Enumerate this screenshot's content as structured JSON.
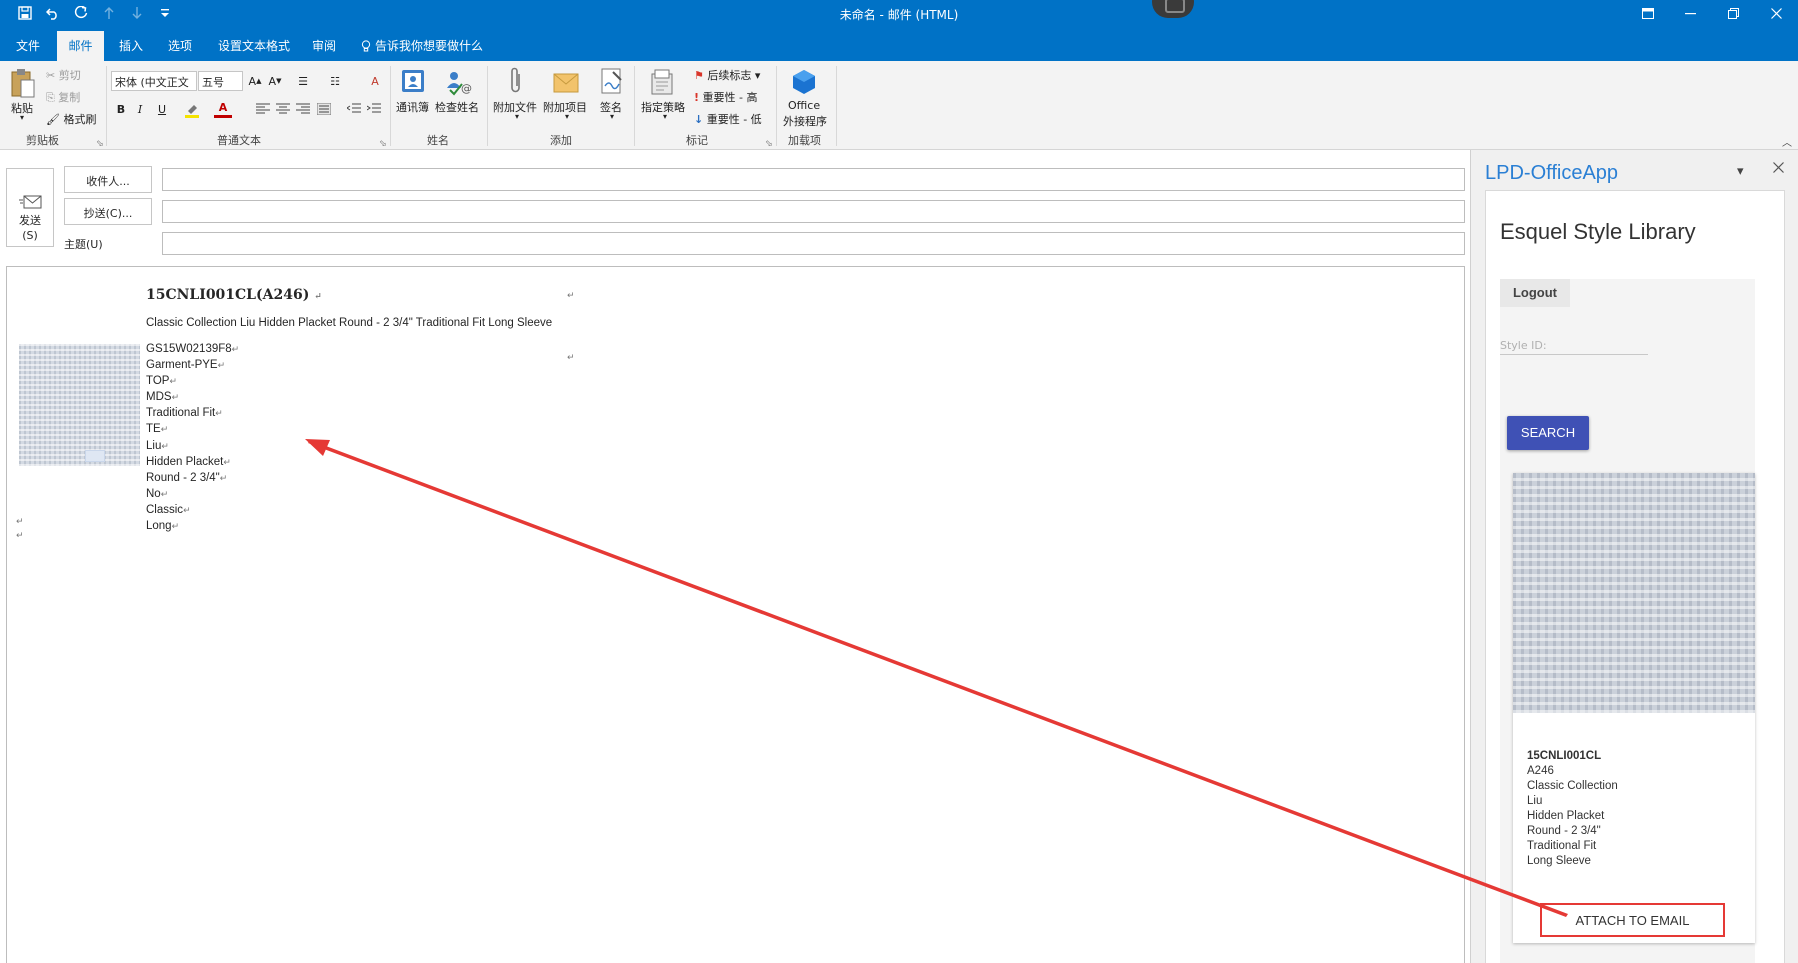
{
  "window": {
    "title": "未命名  -  邮件 (HTML)"
  },
  "tabs": [
    {
      "label": "文件"
    },
    {
      "label": "邮件"
    },
    {
      "label": "插入"
    },
    {
      "label": "选项"
    },
    {
      "label": "设置文本格式"
    },
    {
      "label": "审阅"
    },
    {
      "label": "告诉我你想要做什么"
    }
  ],
  "ribbon": {
    "clipboard": {
      "group_label": "剪贴板",
      "paste": "粘贴",
      "cut": "剪切",
      "copy": "复制",
      "format_painter": "格式刷"
    },
    "basic_text": {
      "group_label": "普通文本",
      "font_name": "宋体 (中文正文",
      "font_size": "五号",
      "bold": "B",
      "italic": "I",
      "underline": "U",
      "font_color_letter": "A"
    },
    "names": {
      "group_label": "姓名",
      "address_book": "通讯簿",
      "check_names": "检查姓名"
    },
    "include": {
      "group_label": "添加",
      "attach_file": "附加文件",
      "attach_item": "附加项目",
      "signature": "签名"
    },
    "tags": {
      "group_label": "标记",
      "assign_policy": "指定策略",
      "follow_up": "后续标志",
      "high_importance": "重要性 - 高",
      "low_importance": "重要性 - 低"
    },
    "addins": {
      "group_label": "加载项",
      "office_addins_line1": "Office",
      "office_addins_line2": "外接程序"
    }
  },
  "compose": {
    "send_label_1": "发送",
    "send_label_2": "(S)",
    "to_button": "收件人...",
    "cc_button": "抄送(C)...",
    "subject_label": "主题(U)",
    "to_value": "",
    "cc_value": "",
    "subject_value": ""
  },
  "body": {
    "title": "15CNLI001CL(A246)",
    "subtitle": "Classic Collection Liu Hidden Placket Round - 2 3/4\" Traditional Fit Long Sleeve",
    "specs": [
      "GS15W02139F8",
      "Garment-PYE",
      "TOP",
      "MDS",
      "Traditional Fit",
      "TE",
      "Liu",
      "Hidden Placket",
      "Round - 2 3/4\"",
      "No",
      "Classic",
      "Long"
    ],
    "para_mark": "↵"
  },
  "pane": {
    "title": "LPD-OfficeApp",
    "library_title": "Esquel Style Library",
    "logout_tab": "Logout",
    "style_id_placeholder": "Style ID:",
    "search_button": "SEARCH",
    "result": {
      "code": "15CNLI001CL",
      "lines": [
        "A246",
        "Classic Collection",
        "Liu",
        "Hidden Placket",
        "Round - 2 3/4\"",
        "Traditional Fit",
        "Long Sleeve"
      ],
      "attach_button": "ATTACH TO EMAIL"
    }
  },
  "colors": {
    "brand_blue": "#0072c6",
    "pane_title": "#2a7fd4",
    "search_button": "#3f51b5",
    "annotation_red": "#e53935"
  }
}
